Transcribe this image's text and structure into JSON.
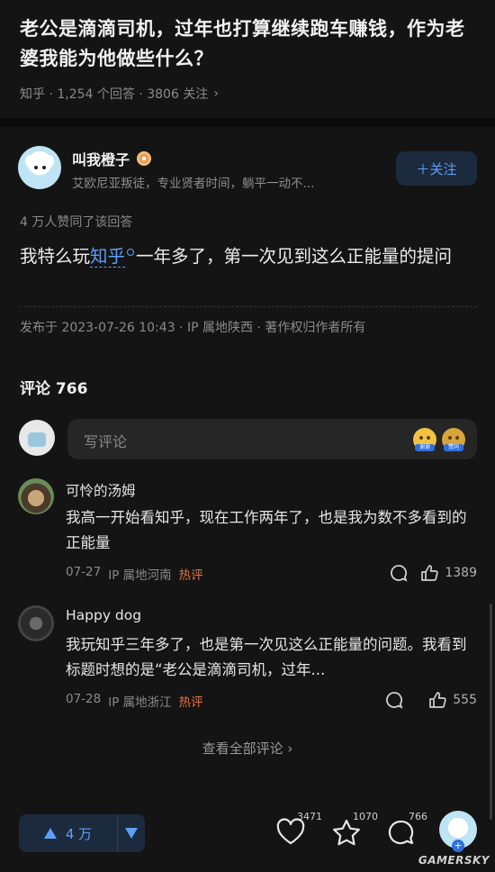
{
  "question": {
    "title": "老公是滴滴司机，过年也打算继续跑车赚钱，作为老婆我能为他做些什么？",
    "meta": "知乎 · 1,254 个回答 · 3806 关注",
    "meta_chevron": "›"
  },
  "author": {
    "name": "叫我橙子",
    "bio": "艾欧尼亚叛徒，专业贤者时间，躺平一动不...",
    "follow_label": "＋关注"
  },
  "answer": {
    "votes_line": "4 万人赞同了该回答",
    "text_before": "我特么玩",
    "keyword": "知乎",
    "text_after": "一年多了，第一次见到这么正能量的提问",
    "published": "发布于 2023-07-26 10:43 · IP 属地陕西 · 著作权归作者所有"
  },
  "comments": {
    "title": "评论 766",
    "input_placeholder": "写评论",
    "emoji_tags": [
      "谢谢",
      "赞同"
    ],
    "items": [
      {
        "name": "可怜的汤姆",
        "text": "我高一开始看知乎，现在工作两年了，也是我为数不多看到的正能量",
        "date": "07-27",
        "ip": "IP 属地河南",
        "hot": "热评",
        "likes": "1389"
      },
      {
        "name": "Happy dog",
        "text": "我玩知乎三年多了，也是第一次见这么正能量的问题。我看到标题时想的是“老公是滴滴司机，过年...",
        "date": "07-28",
        "ip": "IP 属地浙江",
        "hot": "热评",
        "likes": "555"
      }
    ],
    "view_all": "查看全部评论  ›"
  },
  "bottom": {
    "upvote_label": "4 万",
    "likes_count": "3471",
    "favorites_count": "1070",
    "comments_count": "766",
    "plus": "+"
  },
  "watermark": "GAMERSKY",
  "colors": {
    "background": "#141414",
    "accent": "#5f9ff5",
    "hot": "#e0734a",
    "follow_bg": "#1c2a3d"
  }
}
